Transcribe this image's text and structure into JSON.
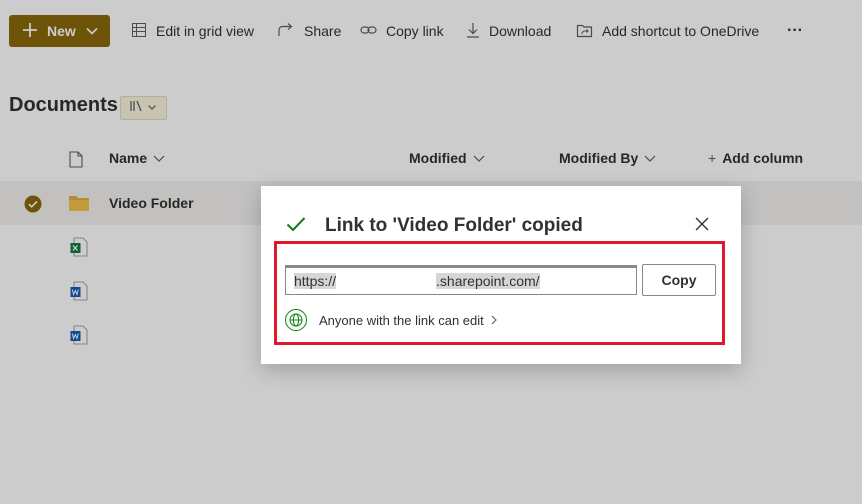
{
  "toolbar": {
    "new_label": "New",
    "edit_grid_label": "Edit in grid view",
    "share_label": "Share",
    "copy_link_label": "Copy link",
    "download_label": "Download",
    "add_shortcut_label": "Add shortcut to OneDrive",
    "more_label": "···"
  },
  "library": {
    "title": "Documents"
  },
  "columns": {
    "name": "Name",
    "modified": "Modified",
    "modified_by": "Modified By",
    "add_column": "Add column"
  },
  "rows": [
    {
      "name": "Video Folder",
      "type": "folder",
      "selected": true
    },
    {
      "name": "",
      "type": "excel"
    },
    {
      "name": "",
      "type": "word"
    },
    {
      "name": "",
      "type": "word"
    }
  ],
  "dialog": {
    "title": "Link to 'Video Folder' copied",
    "link_prefix": "https://",
    "link_domain": ".sharepoint.com/",
    "copy_button": "Copy",
    "permission_text": "Anyone with the link can edit"
  },
  "colors": {
    "accent": "#8a6a0a",
    "success": "#107c10",
    "highlight_border": "#e1182d"
  }
}
